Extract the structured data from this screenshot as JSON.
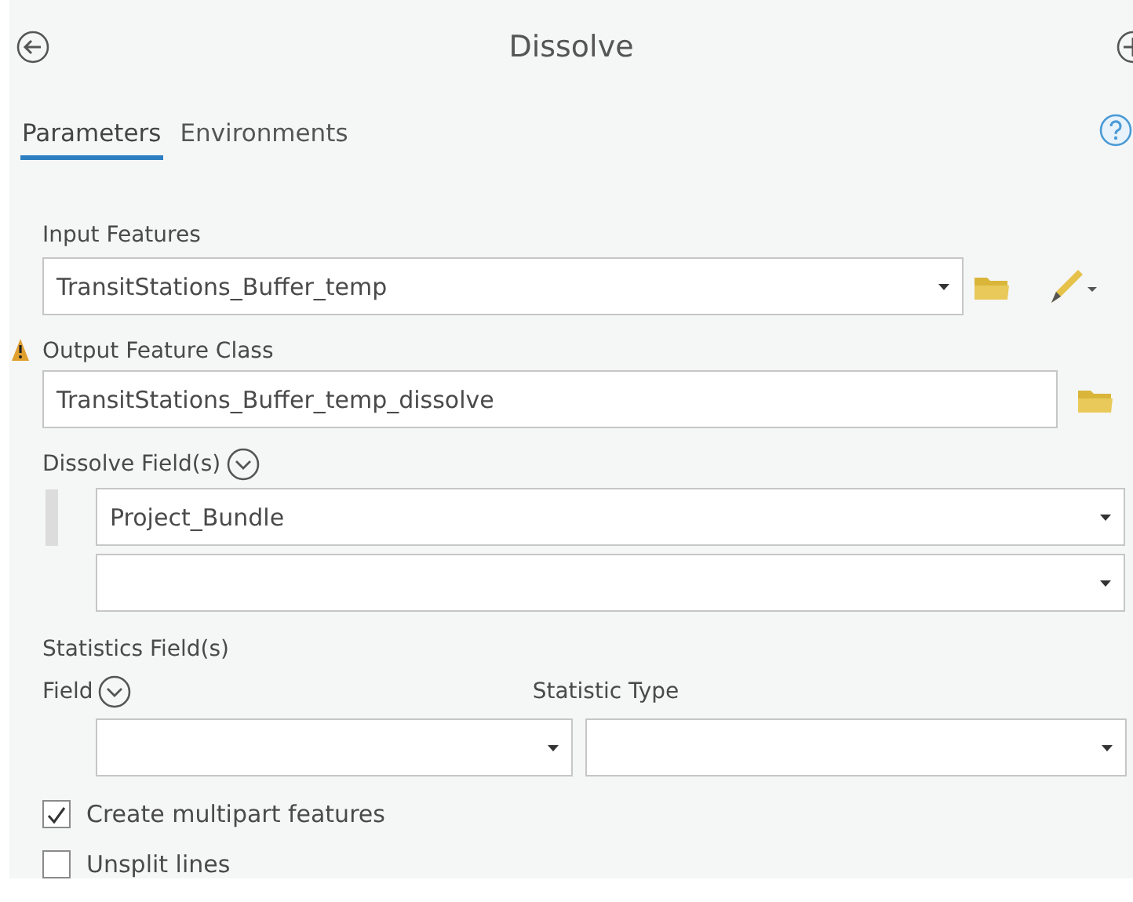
{
  "title": "Dissolve",
  "tabs": [
    {
      "label": "Parameters",
      "selected": true
    },
    {
      "label": "Environments",
      "selected": false
    }
  ],
  "parameters": [
    {
      "kind": "dropdown",
      "label": "Input Features",
      "value": "TransitStations_Buffer_temp",
      "warning": false
    },
    {
      "kind": "text",
      "label": "Output Feature Class",
      "value": "TransitStations_Buffer_temp_dissolve",
      "warning": true
    }
  ],
  "dissolve_fields": {
    "label": "Dissolve Field(s)",
    "rows": [
      {
        "kind": "value",
        "value": "Project_Bundle"
      },
      {
        "kind": "empty"
      }
    ]
  },
  "statistics_fields": {
    "label": "Statistics Field(s)",
    "columns": [
      "Field",
      "Statistic Type"
    ]
  },
  "checkboxes": [
    {
      "label": "Create multipart features",
      "checked": true
    },
    {
      "label": "Unsplit lines",
      "checked": false
    }
  ]
}
